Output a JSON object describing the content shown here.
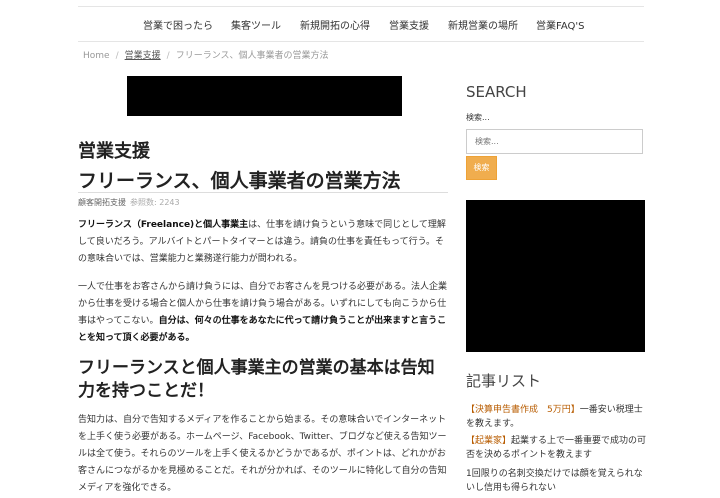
{
  "nav": {
    "items": [
      {
        "label": "営業で困ったら"
      },
      {
        "label": "集客ツール"
      },
      {
        "label": "新規開拓の心得"
      },
      {
        "label": "営業支援"
      },
      {
        "label": "新規営業の場所"
      },
      {
        "label": "営業FAQ'S"
      }
    ]
  },
  "breadcrumb": {
    "home": "Home",
    "sep": "/",
    "category": "営業支援",
    "current": "フリーランス、個人事業者の営業方法"
  },
  "article": {
    "category_title": "営業支援",
    "title": "フリーランス、個人事業者の営業方法",
    "meta_author": "顧客開拓支援",
    "meta_views": "参照数: 2243",
    "p1_bold": "フリーランス（Freelance)と個人事業主",
    "p1_text": "は、仕事を請け負うという意味で同じとして理解して良いだろう。アルバイトとパートタイマーとは違う。請負の仕事を責任もって行う。その意味合いでは、営業能力と業務遂行能力が問われる。",
    "p2_text": "一人で仕事をお客さんから請け負うには、自分でお客さんを見つける必要がある。法人企業から仕事を受ける場合と個人から仕事を請け負う場合がある。いずれにしても向こうから仕事はやってこない。",
    "p2_bold": "自分は、何々の仕事をあなたに代って請け負うことが出来ますと言うことを知って頂く必要がある。",
    "h2": "フリーランスと個人事業主の営業の基本は告知力を持つことだ！",
    "p3_text": "告知力は、自分で告知するメディアを作ることから始まる。その意味合いでインターネットを上手く使う必要がある。ホームページ、Facebook、Twitter、ブログなど使える告知ツールは全て使う。それらのツールを上手く使えるかどうかであるが、ポイントは、どれかがお客さんにつながるかを見極めることだ。それが分かれば、そのツールに特化して自分の告知メディアを強化できる。"
  },
  "sidebar": {
    "search_heading": "SEARCH",
    "search_label": "検索...",
    "search_placeholder": "検索...",
    "search_button": "検索",
    "list_heading": "記事リスト",
    "list_items": [
      {
        "label": "【決算申告書作成　5万円】",
        "text": "一番安い税理士を教えます。"
      },
      {
        "label": "【起業家】",
        "text": "起業する上で一番重要で成功の可否を決めるポイントを教えます"
      },
      {
        "label": "",
        "text": "1回限りの名刺交換だけでは顔を覚えられないし信用も得られない"
      }
    ]
  }
}
